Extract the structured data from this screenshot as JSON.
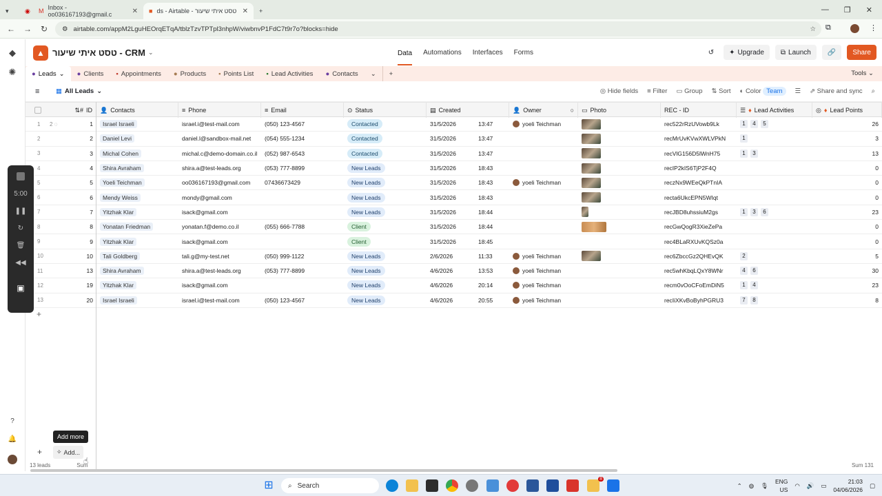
{
  "browser": {
    "tabs": [
      {
        "title": "Inbox - oo036167193@gmail.c",
        "icon": "gmail-icon"
      },
      {
        "title": "ds - Airtable - טסט איתי שיעור",
        "icon": "airtable-icon"
      }
    ],
    "new_tab": "+",
    "url": "airtable.com/appM2LguHEOrqETqA/tblzTzvTPTpl3nhpW/viwbnvP1FdC7t9r7o?blocks=hide"
  },
  "app": {
    "base_name": "טסט איתי שיעור - CRM",
    "nav": [
      "Data",
      "Automations",
      "Interfaces",
      "Forms"
    ],
    "upgrade": "Upgrade",
    "launch": "Launch",
    "share": "Share"
  },
  "tables": {
    "items": [
      "Leads",
      "Clients",
      "Appointments",
      "Products",
      "Points List",
      "Lead Activities",
      "Contacts"
    ],
    "tools": "Tools"
  },
  "view": {
    "name": "All Leads",
    "hide_fields": "Hide fields",
    "filter": "Filter",
    "group": "Group",
    "sort": "Sort",
    "color": "Color",
    "team": "Team",
    "share_sync": "Share and sync"
  },
  "columns": [
    "ID",
    "Contacts",
    "Phone",
    "Email",
    "Status",
    "Created",
    "Owner",
    "Photo",
    "REC - ID",
    "Lead Activities",
    "Lead Points"
  ],
  "rows": [
    {
      "n": "1",
      "id": "1",
      "contact": "Israel Israeli",
      "phone": "israel.i@test-mail.com",
      "email": "(050) 123-4567",
      "status": "Contacted",
      "date": "31/5/2026",
      "time": "13:47",
      "owner": "yoeli Teichman",
      "photo": "p",
      "rec": "rec522rRzUVowb9Lk",
      "acts": [
        "1",
        "4",
        "5"
      ],
      "points": "26"
    },
    {
      "n": "2",
      "id": "2",
      "contact": "Daniel Levi",
      "phone": "daniel.l@sandbox-mail.net",
      "email": "(054) 555-1234",
      "status": "Contacted",
      "date": "31/5/2026",
      "time": "13:47",
      "owner": "",
      "photo": "p",
      "rec": "recMrUvKVwXWLVPkN",
      "acts": [
        "1"
      ],
      "points": "3"
    },
    {
      "n": "3",
      "id": "3",
      "contact": "Michal Cohen",
      "phone": "michal.c@demo-domain.co.il",
      "email": "(052) 987-6543",
      "status": "Contacted",
      "date": "31/5/2026",
      "time": "13:47",
      "owner": "",
      "photo": "p",
      "rec": "recVlG156D5lWnH75",
      "acts": [
        "1",
        "3"
      ],
      "points": "13"
    },
    {
      "n": "4",
      "id": "4",
      "contact": "Shira Avraham",
      "phone": "shira.a@test-leads.org",
      "email": "(053) 777-8899",
      "status": "New Leads",
      "date": "31/5/2026",
      "time": "18:43",
      "owner": "",
      "photo": "p",
      "rec": "recIP2kIS6TjP2F4Q",
      "acts": [],
      "points": "0"
    },
    {
      "n": "5",
      "id": "5",
      "contact": "Yoeli Teichman",
      "phone": "oo036167193@gmail.com",
      "email": "07436673429",
      "status": "New Leads",
      "date": "31/5/2026",
      "time": "18:43",
      "owner": "yoeli Teichman",
      "photo": "p",
      "rec": "reczNx9WEeQkPTnIA",
      "acts": [],
      "points": "0"
    },
    {
      "n": "6",
      "id": "6",
      "contact": "Mendy Weiss",
      "phone": "mondy@gmail.com",
      "email": "",
      "status": "New Leads",
      "date": "31/5/2026",
      "time": "18:43",
      "owner": "",
      "photo": "p",
      "rec": "recta6UkcEPN5WIqt",
      "acts": [],
      "points": "0"
    },
    {
      "n": "7",
      "id": "7",
      "contact": "Yitzhak Klar",
      "phone": "isack@gmail.com",
      "email": "",
      "status": "New Leads",
      "date": "31/5/2026",
      "time": "18:44",
      "owner": "",
      "photo": "s",
      "rec": "recJBD8uhssiuM2gs",
      "acts": [
        "1",
        "3",
        "6"
      ],
      "points": "23"
    },
    {
      "n": "8",
      "id": "8",
      "contact": "Yonatan Friedman",
      "phone": "yonatan.f@demo.co.il",
      "email": "(055) 666-7788",
      "status": "Client",
      "date": "31/5/2026",
      "time": "18:44",
      "owner": "",
      "photo": "w",
      "rec": "recGwQogR3XieZePa",
      "acts": [],
      "points": "0"
    },
    {
      "n": "9",
      "id": "9",
      "contact": "Yitzhak Klar",
      "phone": "isack@gmail.com",
      "email": "",
      "status": "Client",
      "date": "31/5/2026",
      "time": "18:45",
      "owner": "",
      "photo": "",
      "rec": "rec4BLaRXUvKQSz0a",
      "acts": [],
      "points": "0"
    },
    {
      "n": "10",
      "id": "10",
      "contact": "Tali Goldberg",
      "phone": "tali.g@my-test.net",
      "email": "(050) 999-1122",
      "status": "New Leads",
      "date": "2/6/2026",
      "time": "11:33",
      "owner": "yoeli Teichman",
      "photo": "p",
      "rec": "rec6ZbccGz2QHEvQK",
      "acts": [
        "2"
      ],
      "points": "5"
    },
    {
      "n": "11",
      "id": "13",
      "contact": "Shira Avraham",
      "phone": "shira.a@test-leads.org",
      "email": "(053) 777-8899",
      "status": "New Leads",
      "date": "4/6/2026",
      "time": "13:53",
      "owner": "yoeli Teichman",
      "photo": "",
      "rec": "rec5whKbqLQxY8WNr",
      "acts": [
        "4",
        "6"
      ],
      "points": "30"
    },
    {
      "n": "12",
      "id": "19",
      "contact": "Yitzhak Klar",
      "phone": "isack@gmail.com",
      "email": "",
      "status": "New Leads",
      "date": "4/6/2026",
      "time": "20:14",
      "owner": "yoeli Teichman",
      "photo": "",
      "rec": "recm0vOoCFoEmDiN5",
      "acts": [
        "1",
        "4"
      ],
      "points": "23"
    },
    {
      "n": "13",
      "id": "20",
      "contact": "Israel Israeli",
      "phone": "israel.i@test-mail.com",
      "email": "(050) 123-4567",
      "status": "New Leads",
      "date": "4/6/2026",
      "time": "20:55",
      "owner": "yoeli Teichman",
      "photo": "",
      "rec": "recIiXKvBoByhPGRU3",
      "acts": [
        "7",
        "8"
      ],
      "points": "8"
    }
  ],
  "row1_comment": "2",
  "recorder": {
    "time": "5:00"
  },
  "bottom": {
    "tooltip": "Add more",
    "add_label": "Add...",
    "record_count": "13 leads",
    "sum_left": "Sum",
    "sum_right": "Sum 131"
  },
  "taskbar": {
    "search": "Search",
    "lang1": "ENG",
    "lang2": "US",
    "time": "21:03",
    "date": "04/06/2026",
    "badge": "8"
  },
  "colors": {
    "accent": "#e25822",
    "tab_bar": "#fdece6",
    "contacted": "#d6ecf8",
    "new_leads": "#e1ecfa",
    "client": "#d9f2de"
  }
}
